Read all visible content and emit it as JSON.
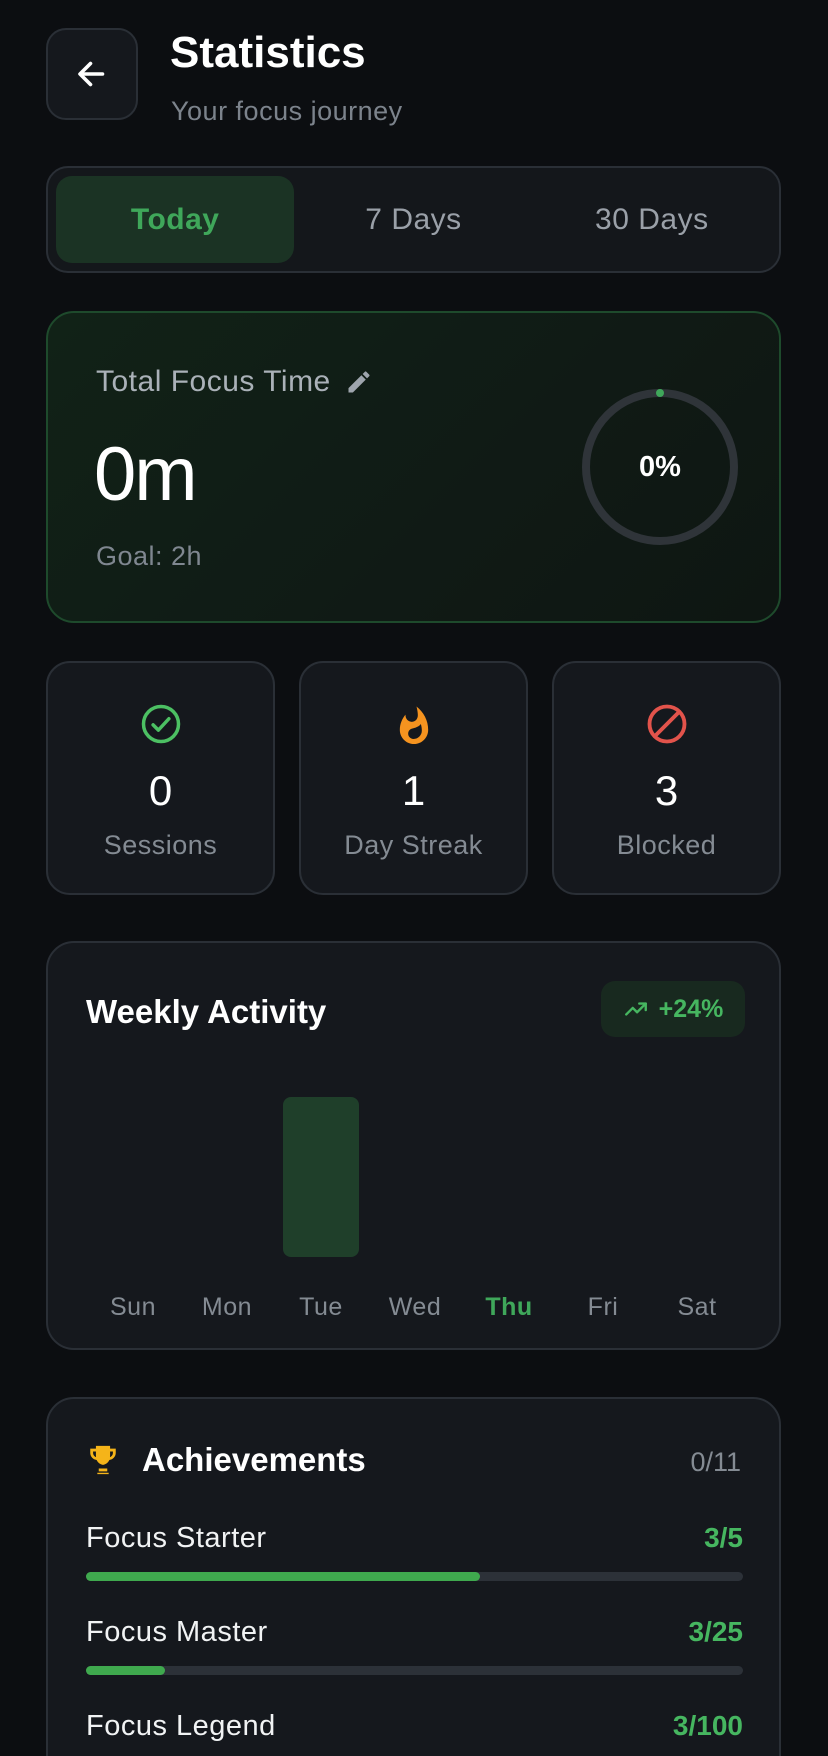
{
  "header": {
    "title": "Statistics",
    "subtitle": "Your focus journey"
  },
  "tabs": [
    {
      "label": "Today",
      "active": true
    },
    {
      "label": "7 Days",
      "active": false
    },
    {
      "label": "30 Days",
      "active": false
    }
  ],
  "focus": {
    "label": "Total Focus Time",
    "value": "0m",
    "goal": "Goal: 2h",
    "percent_text": "0%",
    "percent": 0
  },
  "stats": [
    {
      "icon": "check-circle-icon",
      "value": "0",
      "label": "Sessions",
      "color": "#4cc063"
    },
    {
      "icon": "fire-icon",
      "value": "1",
      "label": "Day Streak",
      "color": "#f5931f"
    },
    {
      "icon": "block-icon",
      "value": "3",
      "label": "Blocked",
      "color": "#e2534b"
    }
  ],
  "weekly": {
    "title": "Weekly Activity",
    "trend": "+24%"
  },
  "chart_data": {
    "type": "bar",
    "categories": [
      "Sun",
      "Mon",
      "Tue",
      "Wed",
      "Thu",
      "Fri",
      "Sat"
    ],
    "values": [
      0,
      0,
      1,
      0,
      0,
      0,
      0
    ],
    "highlight": "Thu",
    "bar_color": "#1f3f2a",
    "highlight_color": "#3fa75a"
  },
  "achievements": {
    "title": "Achievements",
    "count": "0/11",
    "items": [
      {
        "name": "Focus Starter",
        "progress_text": "3/5",
        "progress": 0.6
      },
      {
        "name": "Focus Master",
        "progress_text": "3/25",
        "progress": 0.12
      },
      {
        "name": "Focus Legend",
        "progress_text": "3/100",
        "progress": 0.03
      }
    ]
  },
  "colors": {
    "accent": "#3fa75a",
    "background": "#0c0e11",
    "card": "#15181d"
  }
}
